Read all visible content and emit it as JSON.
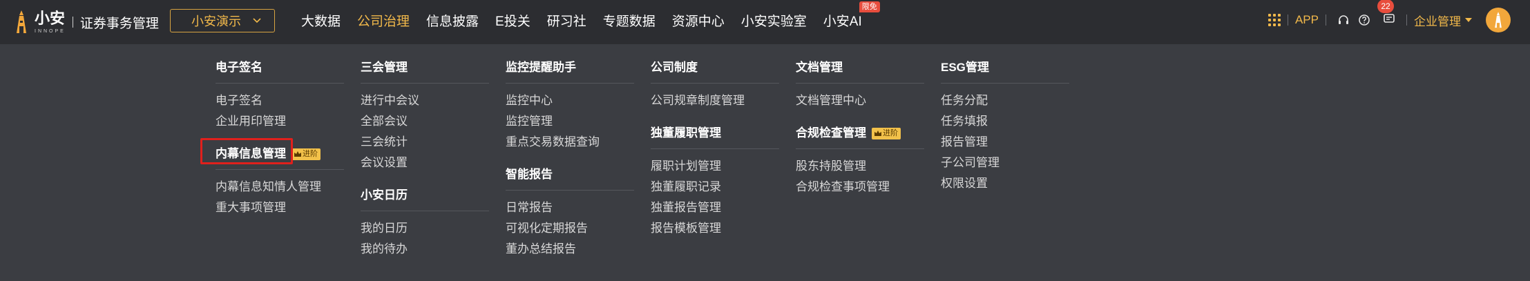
{
  "header": {
    "logo_name": "小安",
    "logo_sub": "INNOPE",
    "system_title": "证券事务管理",
    "company_select": "小安演示",
    "nav": [
      {
        "label": "大数据",
        "active": false
      },
      {
        "label": "公司治理",
        "active": true
      },
      {
        "label": "信息披露",
        "active": false
      },
      {
        "label": "E投关",
        "active": false
      },
      {
        "label": "研习社",
        "active": false
      },
      {
        "label": "专题数据",
        "active": false
      },
      {
        "label": "资源中心",
        "active": false
      },
      {
        "label": "小安实验室",
        "active": false
      },
      {
        "label": "小安AI",
        "active": false,
        "badge": "限免"
      }
    ],
    "app_label": "APP",
    "message_count": "22",
    "enterprise_label": "企业管理"
  },
  "menu": {
    "pro_tag": "进阶",
    "columns": [
      {
        "groups": [
          {
            "title": "电子签名",
            "items": [
              "电子签名",
              "企业用印管理"
            ]
          },
          {
            "title": "内幕信息管理",
            "pro": true,
            "highlighted": true,
            "items": [
              "内幕信息知情人管理",
              "重大事项管理"
            ]
          }
        ]
      },
      {
        "groups": [
          {
            "title": "三会管理",
            "items": [
              "进行中会议",
              "全部会议",
              "三会统计",
              "会议设置"
            ]
          },
          {
            "title": "小安日历",
            "items": [
              "我的日历",
              "我的待办"
            ]
          }
        ]
      },
      {
        "groups": [
          {
            "title": "监控提醒助手",
            "items": [
              "监控中心",
              "监控管理",
              "重点交易数据查询"
            ]
          },
          {
            "title": "智能报告",
            "items": [
              "日常报告",
              "可视化定期报告",
              "董办总结报告"
            ]
          }
        ]
      },
      {
        "groups": [
          {
            "title": "公司制度",
            "items": [
              "公司规章制度管理"
            ]
          },
          {
            "title": "独董履职管理",
            "items": [
              "履职计划管理",
              "独董履职记录",
              "独董报告管理",
              "报告模板管理"
            ]
          }
        ]
      },
      {
        "groups": [
          {
            "title": "文档管理",
            "items": [
              "文档管理中心"
            ]
          },
          {
            "title": "合规检查管理",
            "pro": true,
            "items": [
              "股东持股管理",
              "合规检查事项管理"
            ]
          }
        ]
      },
      {
        "groups": [
          {
            "title": "ESG管理",
            "items": [
              "任务分配",
              "任务填报",
              "报告管理",
              "子公司管理",
              "权限设置"
            ]
          }
        ]
      }
    ]
  },
  "colors": {
    "accent": "#f1b84a",
    "topbar_bg": "#2c2d31",
    "menu_bg": "#3b3d42",
    "badge": "#e84d3d",
    "highlight": "#e0201c"
  }
}
